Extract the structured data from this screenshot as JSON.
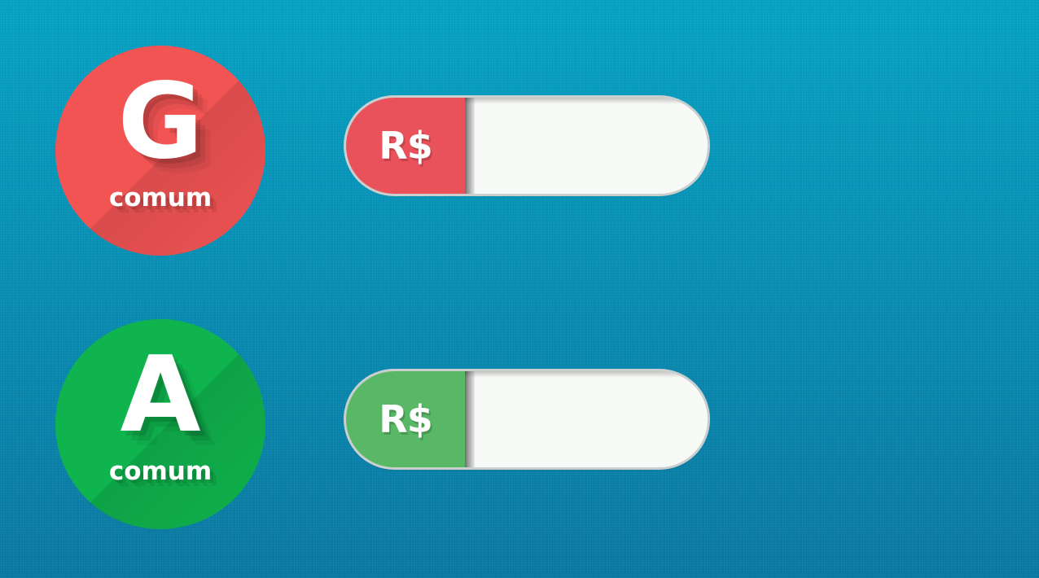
{
  "fuels": [
    {
      "letter": "G",
      "label": "comum",
      "color": "#f25454",
      "currency": "R$",
      "currency_color": "#e9525a",
      "price_value": ""
    },
    {
      "letter": "A",
      "label": "comum",
      "color": "#10b44e",
      "currency": "R$",
      "currency_color": "#58b865",
      "price_value": ""
    }
  ]
}
